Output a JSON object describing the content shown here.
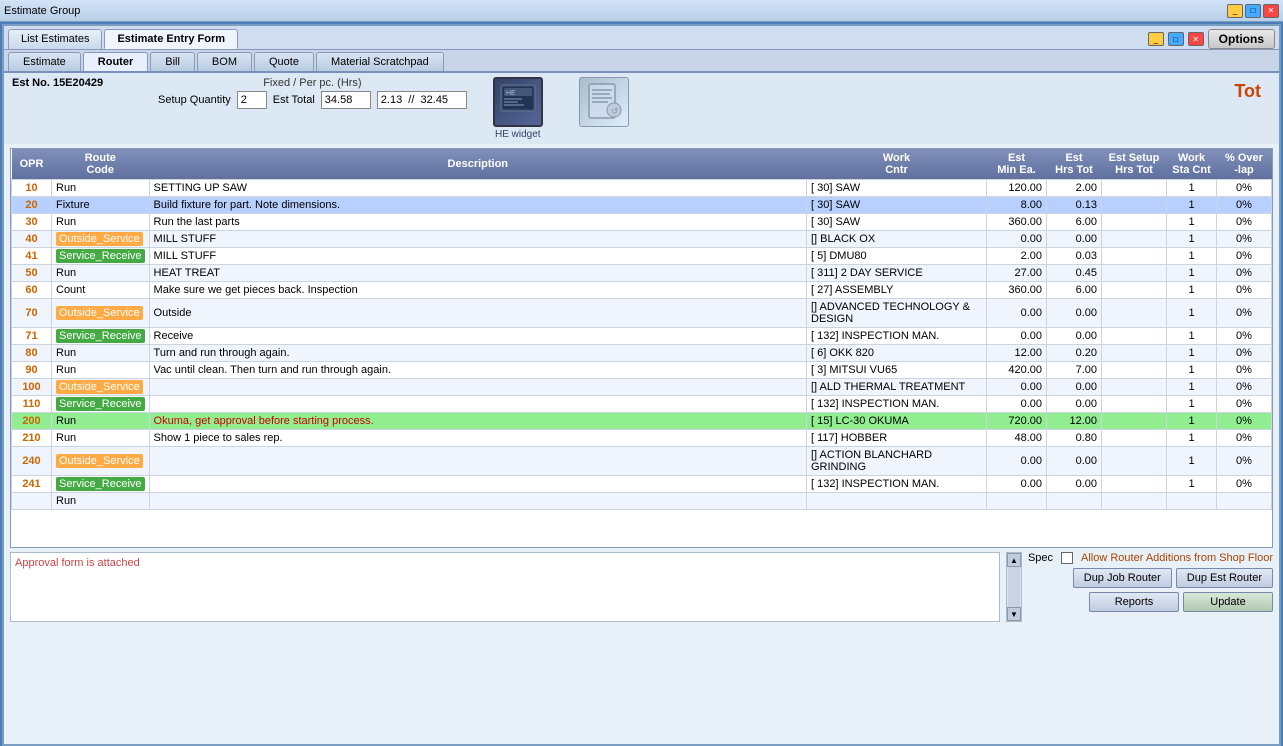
{
  "titleBar": {
    "title": "Estimate Group",
    "closeIcon": "✕"
  },
  "windowControls": {
    "minimize": "_",
    "maximize": "□",
    "close": "✕"
  },
  "topTabs": [
    {
      "label": "List Estimates",
      "active": false
    },
    {
      "label": "Estimate Entry Form",
      "active": true
    }
  ],
  "navTabs": [
    {
      "label": "Estimate",
      "active": false
    },
    {
      "label": "Router",
      "active": true
    },
    {
      "label": "Bill",
      "active": false
    },
    {
      "label": "BOM",
      "active": false
    },
    {
      "label": "Quote",
      "active": false
    },
    {
      "label": "Material Scratchpad",
      "active": false
    }
  ],
  "optionsButton": "Options",
  "header": {
    "estNo": "Est No. 15E20429",
    "setupQtyLabel": "Setup Quantity",
    "setupQtyValue": "2",
    "estTotalLabel": "Est Total",
    "estTotalValue": "34.58",
    "fixedPerPc": "Fixed / Per pc. (Hrs)",
    "fixedValue": "2.13",
    "separator": "//",
    "pcValue": "32.45",
    "widgetLabel": "HE widget"
  },
  "tableHeaders": [
    {
      "key": "opr",
      "label": "OPR"
    },
    {
      "key": "routeCode",
      "label": "Route\nCode"
    },
    {
      "key": "description",
      "label": "Description"
    },
    {
      "key": "workCntr",
      "label": "Work\nCntr"
    },
    {
      "key": "estMinEa",
      "label": "Est\nMin Ea."
    },
    {
      "key": "estHrsTot",
      "label": "Est\nHrs Tot"
    },
    {
      "key": "estSetupHrsTot",
      "label": "Est Setup\nHrs Tot"
    },
    {
      "key": "workStaCnt",
      "label": "Work\nSta Cnt"
    },
    {
      "key": "pctOverlap",
      "label": "% Over\n-lap"
    }
  ],
  "tableRows": [
    {
      "opr": "10",
      "routeCode": "Run",
      "description": "SETTING UP SAW",
      "workCntr": "[ 30]   SAW",
      "estMinEa": "120.00",
      "estHrsTot": "2.00",
      "estSetupHrsTot": "",
      "workStaCnt": "1",
      "pctOverlap": "0%",
      "highlight": "none",
      "routeStyle": "run"
    },
    {
      "opr": "20",
      "routeCode": "Fixture",
      "description": "Build fixture for part. Note dimensions.",
      "workCntr": "[ 30]   SAW",
      "estMinEa": "8.00",
      "estHrsTot": "0.13",
      "estSetupHrsTot": "",
      "workStaCnt": "1",
      "pctOverlap": "0%",
      "highlight": "blue",
      "routeStyle": "run"
    },
    {
      "opr": "30",
      "routeCode": "Run",
      "description": "Run the last parts",
      "workCntr": "[ 30]   SAW",
      "estMinEa": "360.00",
      "estHrsTot": "6.00",
      "estSetupHrsTot": "",
      "workStaCnt": "1",
      "pctOverlap": "0%",
      "highlight": "none",
      "routeStyle": "run"
    },
    {
      "opr": "40",
      "routeCode": "Outside_Service",
      "description": "MILL STUFF",
      "workCntr": "[] BLACK OX",
      "estMinEa": "0.00",
      "estHrsTot": "0.00",
      "estSetupHrsTot": "",
      "workStaCnt": "1",
      "pctOverlap": "0%",
      "highlight": "none",
      "routeStyle": "outside"
    },
    {
      "opr": "41",
      "routeCode": "Service_Receive",
      "description": "MILL STUFF",
      "workCntr": "[ 5]   DMU80",
      "estMinEa": "2.00",
      "estHrsTot": "0.03",
      "estSetupHrsTot": "",
      "workStaCnt": "1",
      "pctOverlap": "0%",
      "highlight": "none",
      "routeStyle": "service"
    },
    {
      "opr": "50",
      "routeCode": "Run",
      "description": "HEAT TREAT",
      "workCntr": "[ 311]   2 DAY SERVICE",
      "estMinEa": "27.00",
      "estHrsTot": "0.45",
      "estSetupHrsTot": "",
      "workStaCnt": "1",
      "pctOverlap": "0%",
      "highlight": "none",
      "routeStyle": "run"
    },
    {
      "opr": "60",
      "routeCode": "Count",
      "description": "Make sure we get pieces back. Inspection",
      "workCntr": "[ 27]   ASSEMBLY",
      "estMinEa": "360.00",
      "estHrsTot": "6.00",
      "estSetupHrsTot": "",
      "workStaCnt": "1",
      "pctOverlap": "0%",
      "highlight": "none",
      "routeStyle": "run"
    },
    {
      "opr": "70",
      "routeCode": "Outside_Service",
      "description": "Outside",
      "workCntr": "[] ADVANCED TECHNOLOGY & DESIGN",
      "estMinEa": "0.00",
      "estHrsTot": "0.00",
      "estSetupHrsTot": "",
      "workStaCnt": "1",
      "pctOverlap": "0%",
      "highlight": "none",
      "routeStyle": "outside"
    },
    {
      "opr": "71",
      "routeCode": "Service_Receive",
      "description": "Receive",
      "workCntr": "[ 132]   INSPECTION MAN.",
      "estMinEa": "0.00",
      "estHrsTot": "0.00",
      "estSetupHrsTot": "",
      "workStaCnt": "1",
      "pctOverlap": "0%",
      "highlight": "none",
      "routeStyle": "service"
    },
    {
      "opr": "80",
      "routeCode": "Run",
      "description": "Turn and run through again.",
      "workCntr": "[ 6]   OKK 820",
      "estMinEa": "12.00",
      "estHrsTot": "0.20",
      "estSetupHrsTot": "",
      "workStaCnt": "1",
      "pctOverlap": "0%",
      "highlight": "none",
      "routeStyle": "run"
    },
    {
      "opr": "90",
      "routeCode": "Run",
      "description": "Vac until clean. Then turn and run through again.",
      "workCntr": "[ 3]   MITSUI VU65",
      "estMinEa": "420.00",
      "estHrsTot": "7.00",
      "estSetupHrsTot": "",
      "workStaCnt": "1",
      "pctOverlap": "0%",
      "highlight": "none",
      "routeStyle": "run"
    },
    {
      "opr": "100",
      "routeCode": "Outside_Service",
      "description": "",
      "workCntr": "[] ALD THERMAL TREATMENT",
      "estMinEa": "0.00",
      "estHrsTot": "0.00",
      "estSetupHrsTot": "",
      "workStaCnt": "1",
      "pctOverlap": "0%",
      "highlight": "none",
      "routeStyle": "outside"
    },
    {
      "opr": "110",
      "routeCode": "Service_Receive",
      "description": "",
      "workCntr": "[ 132]   INSPECTION MAN.",
      "estMinEa": "0.00",
      "estHrsTot": "0.00",
      "estSetupHrsTot": "",
      "workStaCnt": "1",
      "pctOverlap": "0%",
      "highlight": "none",
      "routeStyle": "service"
    },
    {
      "opr": "200",
      "routeCode": "Run",
      "description": "Okuma, get approval before starting process.",
      "workCntr": "[ 15]   LC-30   OKUMA",
      "estMinEa": "720.00",
      "estHrsTot": "12.00",
      "estSetupHrsTot": "",
      "workStaCnt": "1",
      "pctOverlap": "0%",
      "highlight": "green",
      "routeStyle": "run"
    },
    {
      "opr": "210",
      "routeCode": "Run",
      "description": "Show 1 piece to sales rep.",
      "workCntr": "[ 117]   HOBBER",
      "estMinEa": "48.00",
      "estHrsTot": "0.80",
      "estSetupHrsTot": "",
      "workStaCnt": "1",
      "pctOverlap": "0%",
      "highlight": "none",
      "routeStyle": "run"
    },
    {
      "opr": "240",
      "routeCode": "Outside_Service",
      "description": "",
      "workCntr": "[] ACTION BLANCHARD GRINDING",
      "estMinEa": "0.00",
      "estHrsTot": "0.00",
      "estSetupHrsTot": "",
      "workStaCnt": "1",
      "pctOverlap": "0%",
      "highlight": "none",
      "routeStyle": "outside"
    },
    {
      "opr": "241",
      "routeCode": "Service_Receive",
      "description": "",
      "workCntr": "[ 132]   INSPECTION MAN.",
      "estMinEa": "0.00",
      "estHrsTot": "0.00",
      "estSetupHrsTot": "",
      "workStaCnt": "1",
      "pctOverlap": "0%",
      "highlight": "none",
      "routeStyle": "service"
    },
    {
      "opr": "",
      "routeCode": "Run",
      "description": "",
      "workCntr": "",
      "estMinEa": "",
      "estHrsTot": "",
      "estSetupHrsTot": "",
      "workStaCnt": "",
      "pctOverlap": "",
      "highlight": "none",
      "routeStyle": "run"
    }
  ],
  "bottomArea": {
    "approvalText": "Approval form is attached",
    "specLabel": "Spec",
    "allowRouterLabel": "Allow Router Additions from Shop Floor",
    "dupJobRouterBtn": "Dup Job Router",
    "dupEstRouterBtn": "Dup Est Router",
    "reportsBtn": "Reports",
    "updateBtn": "Update"
  },
  "totLabel": "Tot"
}
